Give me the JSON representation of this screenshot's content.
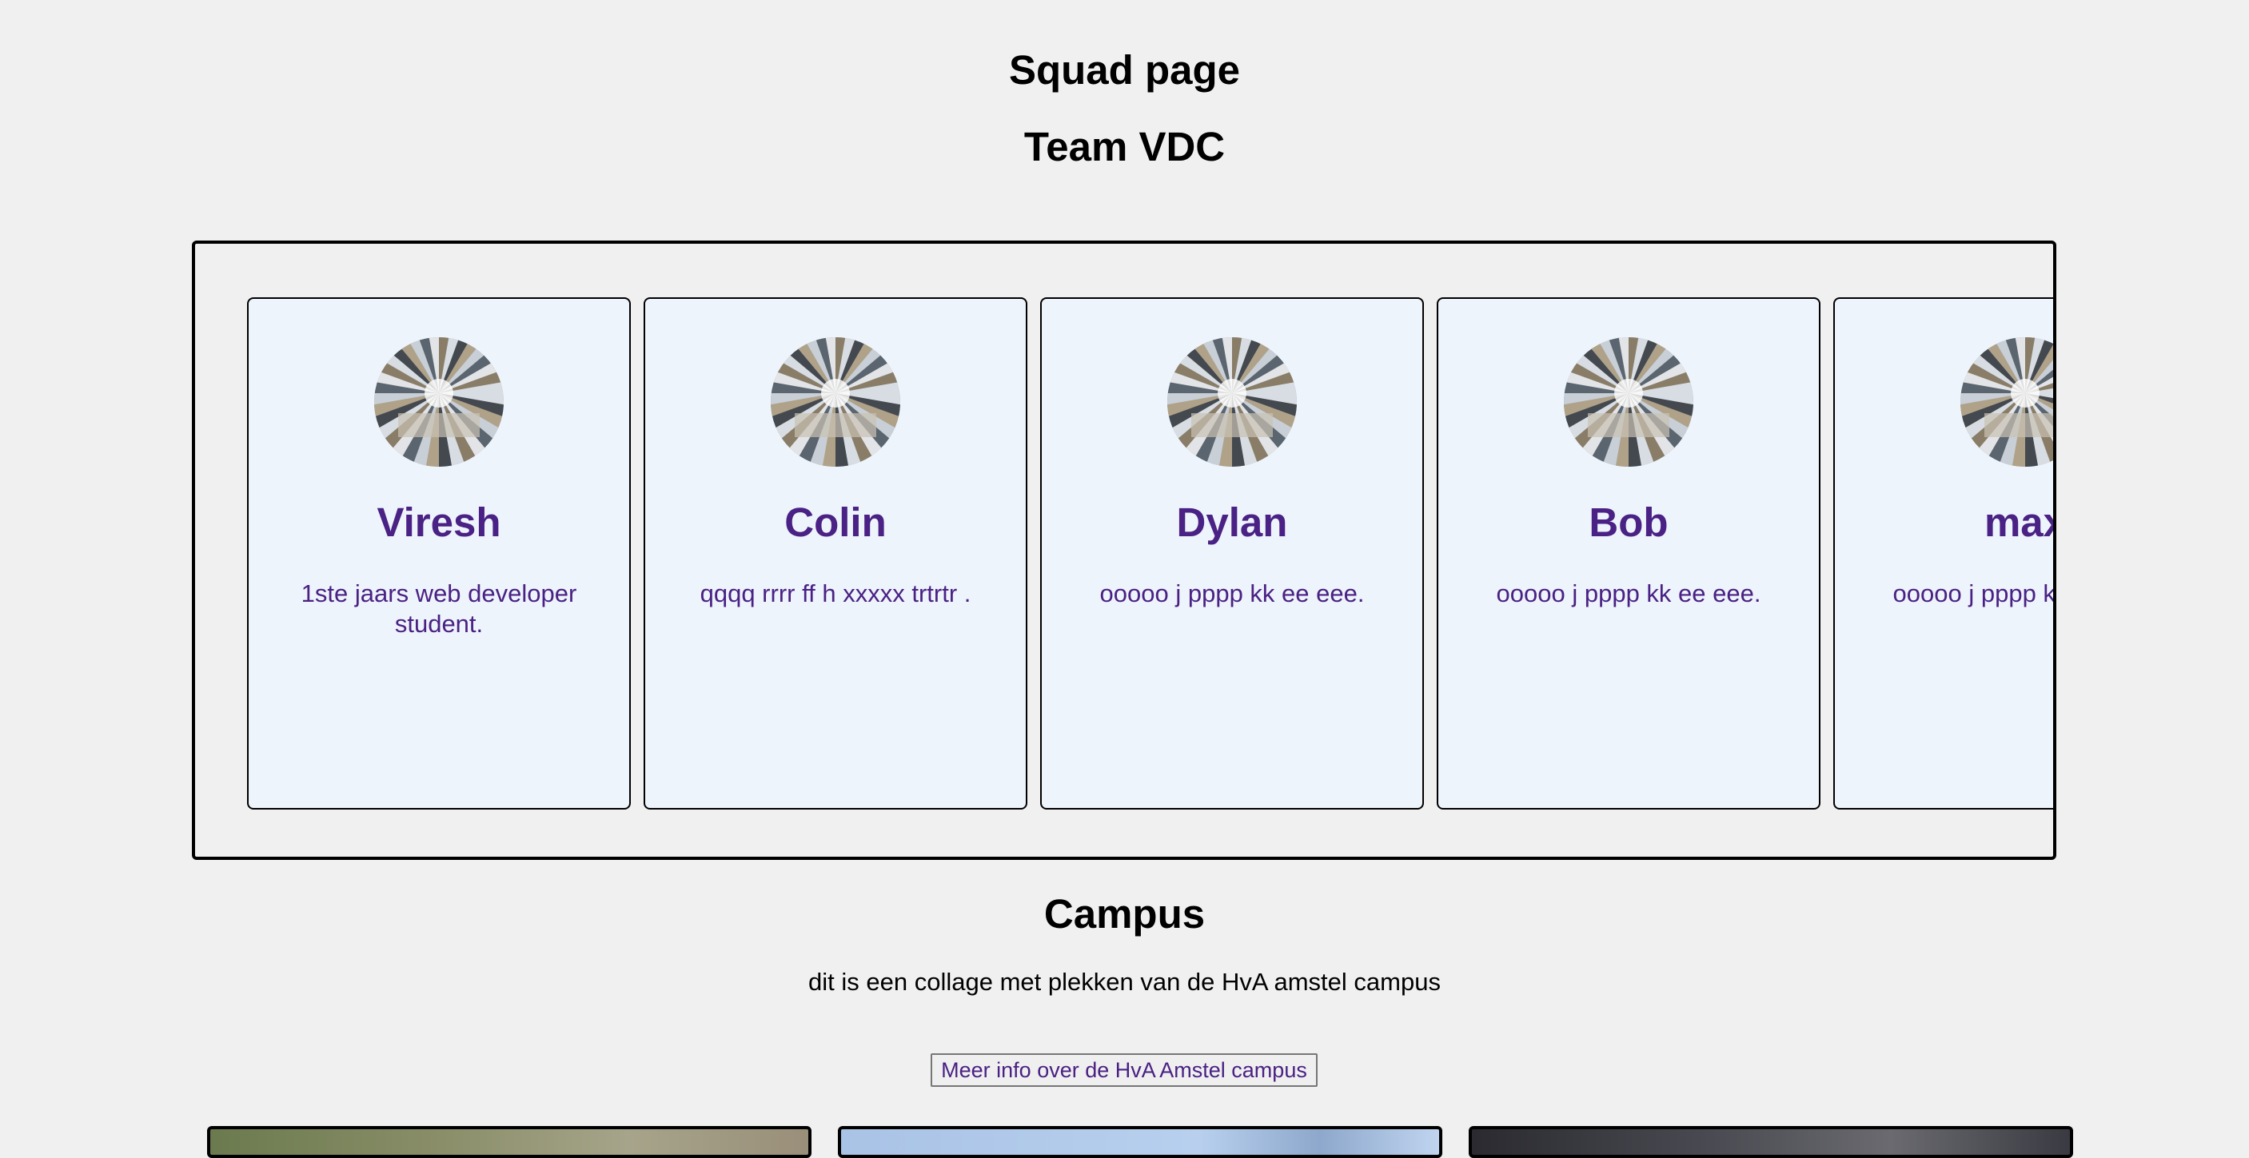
{
  "page": {
    "title": "Squad page",
    "team_title": "Team VDC"
  },
  "members": [
    {
      "name": "Viresh",
      "description": "1ste jaars web developer student."
    },
    {
      "name": "Colin",
      "description": "qqqq rrrr ff h xxxxx trtrtr ."
    },
    {
      "name": "Dylan",
      "description": "ooooo j pppp kk ee eee."
    },
    {
      "name": "Bob",
      "description": "ooooo j pppp kk ee eee."
    },
    {
      "name": "max",
      "description": "ooooo j pppp kk ee eee."
    }
  ],
  "campus": {
    "title": "Campus",
    "text": "dit is een collage met plekken van de HvA amstel campus",
    "button_label": "Meer info over de HvA Amstel campus"
  },
  "colors": {
    "background": "#f0f0f0",
    "card_background": "#eef4fb",
    "accent_purple": "#4a2184"
  },
  "icons": {
    "avatar": "campus-atrium-photo"
  }
}
